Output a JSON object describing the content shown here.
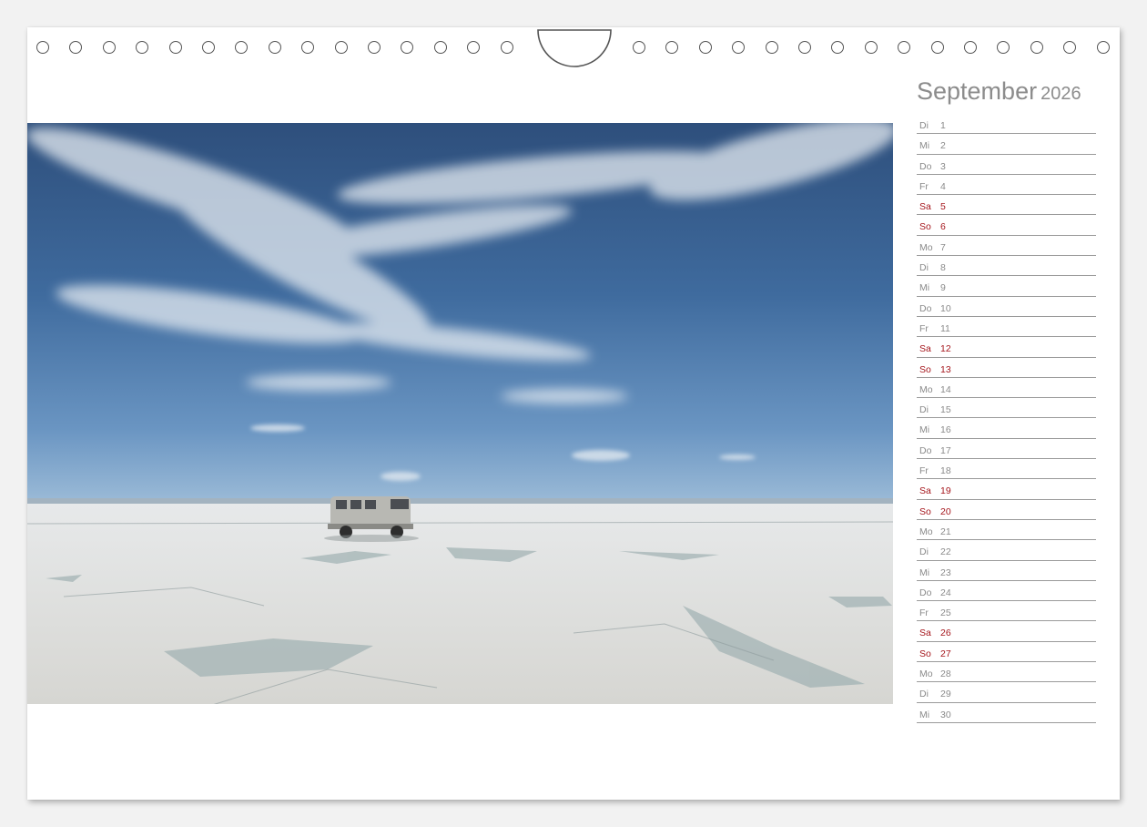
{
  "calendar": {
    "month": "September",
    "year": "2026",
    "weekend_color": "#a5161c",
    "text_color": "#8a8a8a",
    "days": [
      {
        "wd": "Di",
        "d": "1",
        "weekend": false
      },
      {
        "wd": "Mi",
        "d": "2",
        "weekend": false
      },
      {
        "wd": "Do",
        "d": "3",
        "weekend": false
      },
      {
        "wd": "Fr",
        "d": "4",
        "weekend": false
      },
      {
        "wd": "Sa",
        "d": "5",
        "weekend": true
      },
      {
        "wd": "So",
        "d": "6",
        "weekend": true
      },
      {
        "wd": "Mo",
        "d": "7",
        "weekend": false
      },
      {
        "wd": "Di",
        "d": "8",
        "weekend": false
      },
      {
        "wd": "Mi",
        "d": "9",
        "weekend": false
      },
      {
        "wd": "Do",
        "d": "10",
        "weekend": false
      },
      {
        "wd": "Fr",
        "d": "11",
        "weekend": false
      },
      {
        "wd": "Sa",
        "d": "12",
        "weekend": true
      },
      {
        "wd": "So",
        "d": "13",
        "weekend": true
      },
      {
        "wd": "Mo",
        "d": "14",
        "weekend": false
      },
      {
        "wd": "Di",
        "d": "15",
        "weekend": false
      },
      {
        "wd": "Mi",
        "d": "16",
        "weekend": false
      },
      {
        "wd": "Do",
        "d": "17",
        "weekend": false
      },
      {
        "wd": "Fr",
        "d": "18",
        "weekend": false
      },
      {
        "wd": "Sa",
        "d": "19",
        "weekend": true
      },
      {
        "wd": "So",
        "d": "20",
        "weekend": true
      },
      {
        "wd": "Mo",
        "d": "21",
        "weekend": false
      },
      {
        "wd": "Di",
        "d": "22",
        "weekend": false
      },
      {
        "wd": "Mi",
        "d": "23",
        "weekend": false
      },
      {
        "wd": "Do",
        "d": "24",
        "weekend": false
      },
      {
        "wd": "Fr",
        "d": "25",
        "weekend": false
      },
      {
        "wd": "Sa",
        "d": "26",
        "weekend": true
      },
      {
        "wd": "So",
        "d": "27",
        "weekend": true
      },
      {
        "wd": "Mo",
        "d": "28",
        "weekend": false
      },
      {
        "wd": "Di",
        "d": "29",
        "weekend": false
      },
      {
        "wd": "Mi",
        "d": "30",
        "weekend": false
      }
    ]
  }
}
